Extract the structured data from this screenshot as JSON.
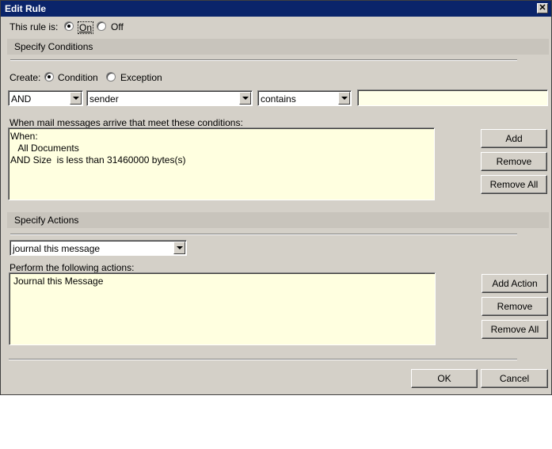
{
  "window": {
    "title": "Edit Rule",
    "close_glyph": "✕"
  },
  "rule_state": {
    "label": "This rule is:",
    "on_label": "On",
    "off_label": "Off",
    "selected": "On"
  },
  "conditions": {
    "section_title": "Specify Conditions",
    "create_label": "Create:",
    "condition_label": "Condition",
    "exception_label": "Exception",
    "selected": "Condition",
    "logic_select": "AND",
    "field_select": "sender",
    "operator_select": "contains",
    "value_input": "",
    "list_label": "When mail messages arrive that meet these conditions:",
    "lines": [
      "When:",
      "   All Documents",
      "AND Size  is less than 31460000 bytes(s)"
    ],
    "buttons": {
      "add": "Add",
      "remove": "Remove",
      "remove_all": "Remove All"
    }
  },
  "actions": {
    "section_title": "Specify Actions",
    "action_select": "journal this message",
    "list_label": "Perform the following actions:",
    "lines": [
      "Journal this Message"
    ],
    "buttons": {
      "add_action": "Add Action",
      "remove": "Remove",
      "remove_all": "Remove All"
    }
  },
  "footer": {
    "ok": "OK",
    "cancel": "Cancel"
  }
}
